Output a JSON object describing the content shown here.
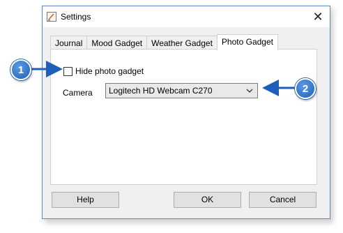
{
  "window": {
    "title": "Settings",
    "close_symbol": "✕"
  },
  "tabs": [
    {
      "label": "Journal",
      "active": false
    },
    {
      "label": "Mood Gadget",
      "active": false
    },
    {
      "label": "Weather Gadget",
      "active": false
    },
    {
      "label": "Photo Gadget",
      "active": true
    }
  ],
  "photo_gadget": {
    "hide_checkbox": {
      "label": "Hide photo gadget",
      "checked": false
    },
    "camera": {
      "label": "Camera",
      "selected": "Logitech HD Webcam C270"
    }
  },
  "buttons": {
    "help": "Help",
    "ok": "OK",
    "cancel": "Cancel"
  },
  "callouts": [
    {
      "number": "1"
    },
    {
      "number": "2"
    }
  ],
  "colors": {
    "accent": "#1e5fb8",
    "window_border": "#5c86c4"
  }
}
